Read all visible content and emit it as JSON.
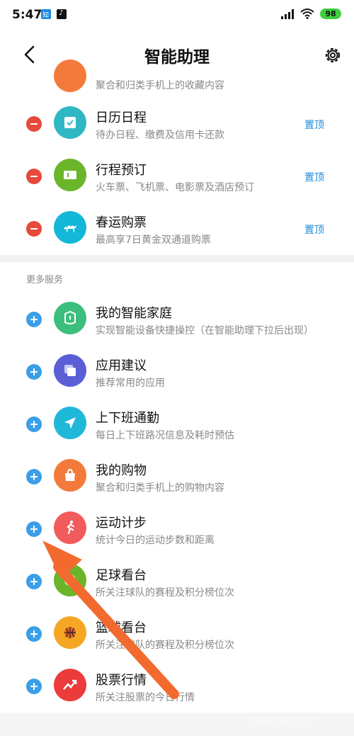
{
  "status_bar": {
    "time": "5:47",
    "battery": "98"
  },
  "header": {
    "title": "智能助理"
  },
  "pinned": [
    {
      "title": "日历日程",
      "desc": "待办日程、缴费及信用卡还款",
      "pin": "置顶",
      "color": "#2fb8c4"
    },
    {
      "title": "行程预订",
      "desc": "火车票、飞机票、电影票及酒店预订",
      "pin": "置顶",
      "color": "#6bb52a"
    },
    {
      "title": "春运购票",
      "desc": "最高享7日黄金双通道购票",
      "pin": "置顶",
      "color": "#13b7d8"
    }
  ],
  "partial_row": {
    "desc": "聚合和归类手机上的收藏内容",
    "color": "#f47a3b"
  },
  "more_services": {
    "label": "更多服务",
    "items": [
      {
        "title": "我的智能家庭",
        "desc": "实现智能设备快捷操控（在智能助理下拉后出现）",
        "color": "#3cbf7c"
      },
      {
        "title": "应用建议",
        "desc": "推荐常用的应用",
        "color": "#5b5fd6"
      },
      {
        "title": "上下班通勤",
        "desc": "每日上下班路况信息及耗时预估",
        "color": "#20b8d8"
      },
      {
        "title": "我的购物",
        "desc": "聚合和归类手机上的购物内容",
        "color": "#f47a3b"
      },
      {
        "title": "运动计步",
        "desc": "统计今日的运动步数和距离",
        "color": "#f25b5b"
      },
      {
        "title": "足球看台",
        "desc": "所关注球队的赛程及积分榜位次",
        "color": "#6bb52a"
      },
      {
        "title": "篮球看台",
        "desc": "所关注球队的赛程及积分榜位次",
        "color": "#f5a623"
      },
      {
        "title": "股票行情",
        "desc": "所关注股票的今日行情",
        "color": "#ec3b3b"
      }
    ]
  },
  "watermark": {
    "text": "Bai 经验",
    "sub": "jingyan.baidu.com"
  }
}
